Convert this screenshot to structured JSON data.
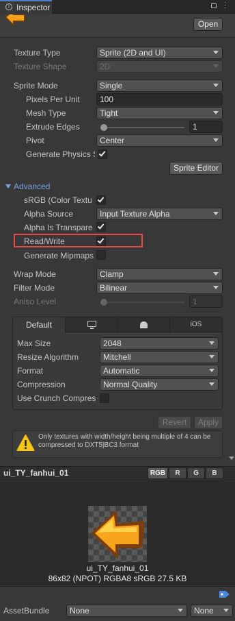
{
  "tab": {
    "title": "Inspector"
  },
  "header": {
    "open_label": "Open"
  },
  "texture": {
    "texture_type_label": "Texture Type",
    "texture_type_value": "Sprite (2D and UI)",
    "texture_shape_label": "Texture Shape",
    "texture_shape_value": "2D",
    "sprite_mode_label": "Sprite Mode",
    "sprite_mode_value": "Single",
    "ppu_label": "Pixels Per Unit",
    "ppu_value": "100",
    "mesh_type_label": "Mesh Type",
    "mesh_type_value": "Tight",
    "extrude_label": "Extrude Edges",
    "extrude_value": "1",
    "extrude_slider_fraction": 0.03,
    "pivot_label": "Pivot",
    "pivot_value": "Center",
    "gen_physics_label": "Generate Physics S",
    "sprite_editor_label": "Sprite Editor"
  },
  "advanced": {
    "header": "Advanced",
    "srgb_label": "sRGB (Color Textu",
    "alpha_source_label": "Alpha Source",
    "alpha_source_value": "Input Texture Alpha",
    "alpha_transparency_label": "Alpha Is Transpare",
    "read_write_label": "Read/Write",
    "mipmaps_label": "Generate Mipmaps"
  },
  "sampling": {
    "wrap_label": "Wrap Mode",
    "wrap_value": "Clamp",
    "filter_label": "Filter Mode",
    "filter_value": "Bilinear",
    "aniso_label": "Aniso Level",
    "aniso_value": "1"
  },
  "platform": {
    "tabs": [
      "Default",
      "",
      "",
      "iOS"
    ],
    "max_size_label": "Max Size",
    "max_size_value": "2048",
    "resize_label": "Resize Algorithm",
    "resize_value": "Mitchell",
    "format_label": "Format",
    "format_value": "Automatic",
    "compression_label": "Compression",
    "compression_value": "Normal Quality",
    "crunch_label": "Use Crunch Compres"
  },
  "actions": {
    "revert": "Revert",
    "apply": "Apply"
  },
  "warning": {
    "text": "Only textures with width/height being multiple of 4 can be compressed to DXT5|BC3 format"
  },
  "preview": {
    "name": "ui_TY_fanhui_01",
    "channels": [
      "RGB",
      "R",
      "G",
      "B"
    ],
    "image_name": "ui_TY_fanhui_01",
    "info": "86x82 (NPOT)  RGBA8 sRGB   27.5 KB"
  },
  "footer": {
    "assetbundle_label": "AssetBundle",
    "bundle_value": "None",
    "variant_value": "None"
  },
  "colors": {
    "accent": "#7aa5e0",
    "highlight": "#e84848",
    "background": "#383838"
  }
}
